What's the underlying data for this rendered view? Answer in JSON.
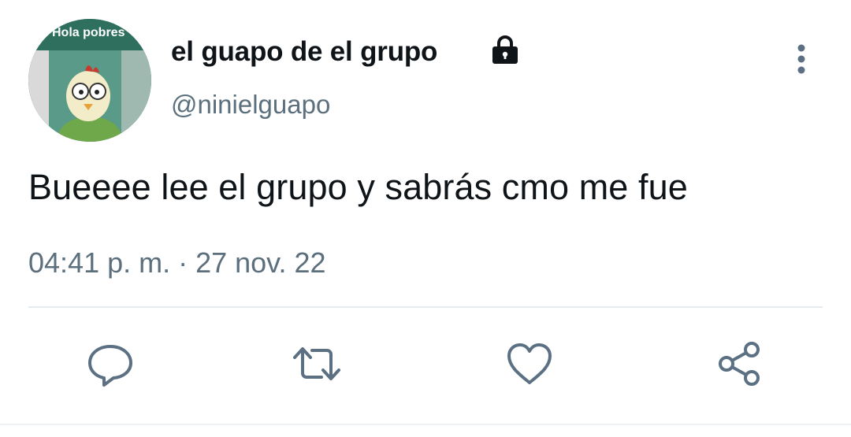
{
  "author": {
    "display_name": "el guapo de el grupo",
    "handle": "@ninielguapo",
    "avatar_caption": "Hola pobres",
    "protected_icon": "lock-icon"
  },
  "tweet": {
    "text": "Bueeee lee el grupo y sabrás cmo me fue",
    "timestamp": "04:41 p. m. · 27 nov. 22"
  },
  "menu": {
    "icon": "more-vertical-icon"
  },
  "actions": [
    {
      "name": "reply",
      "icon": "reply-icon"
    },
    {
      "name": "retweet",
      "icon": "retweet-icon"
    },
    {
      "name": "like",
      "icon": "heart-icon"
    },
    {
      "name": "share",
      "icon": "share-icon"
    }
  ],
  "colors": {
    "text": "#0f1419",
    "secondary_text": "#5b6f7d",
    "icon": "#5b7083",
    "divider": "#e6ecf0"
  }
}
